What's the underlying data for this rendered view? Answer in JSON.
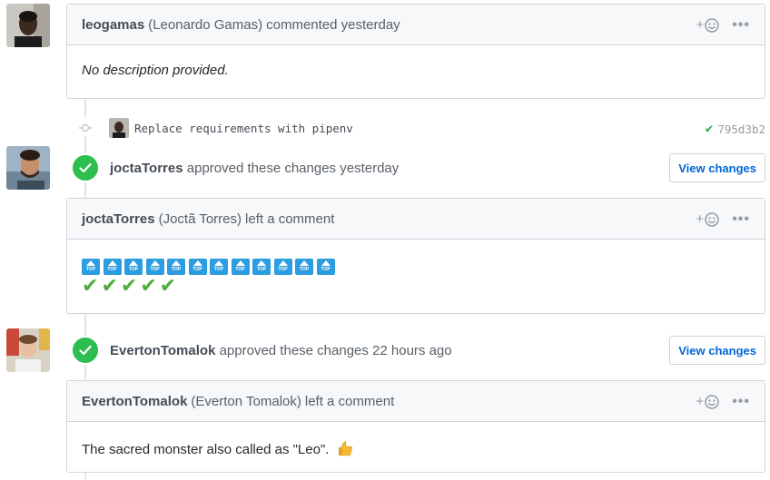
{
  "comments": [
    {
      "author": "leogamas",
      "full_name": "(Leonardo Gamas)",
      "action": "commented yesterday",
      "body": "No description provided."
    },
    {
      "author": "joctaTorres",
      "full_name": "(Joctã Torres)",
      "action": "left a comment"
    },
    {
      "author": "EvertonTomalok",
      "full_name": "(Everton Tomalok)",
      "action": "left a comment",
      "body": "The sacred monster also called as \"Leo\"."
    }
  ],
  "commit": {
    "message": "Replace requirements with pipenv",
    "sha": "795d3b2"
  },
  "reviews": [
    {
      "author": "joctaTorres",
      "text": "approved these changes yesterday",
      "button": "View changes"
    },
    {
      "author": "EvertonTomalok",
      "text": "approved these changes 22 hours ago",
      "button": "View changes"
    }
  ],
  "reaction_add": "+",
  "top_emoji_label": "TOP",
  "top_emoji_count": 12,
  "check_emoji_count": 5,
  "colors": {
    "approved": "#2cbe4e",
    "link": "#0366d6",
    "border": "#d1d5da",
    "header_bg": "#f6f8fa"
  }
}
